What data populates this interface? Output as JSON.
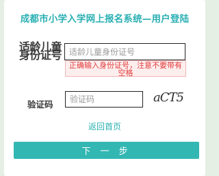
{
  "header": {
    "title": "成都市小学入学网上报名系统—用户登陆"
  },
  "form": {
    "id_label_line1": "适龄儿童",
    "id_label_line2": "身份证号",
    "id_placeholder": "适龄儿童身份证号",
    "id_error": "正确输入身份证号，注意不要带有空格",
    "captcha_label": "验证码",
    "captcha_placeholder": "验证码",
    "captcha_text": "aCT5"
  },
  "actions": {
    "back_link": "返回首页",
    "next_button": "下 一 步"
  }
}
